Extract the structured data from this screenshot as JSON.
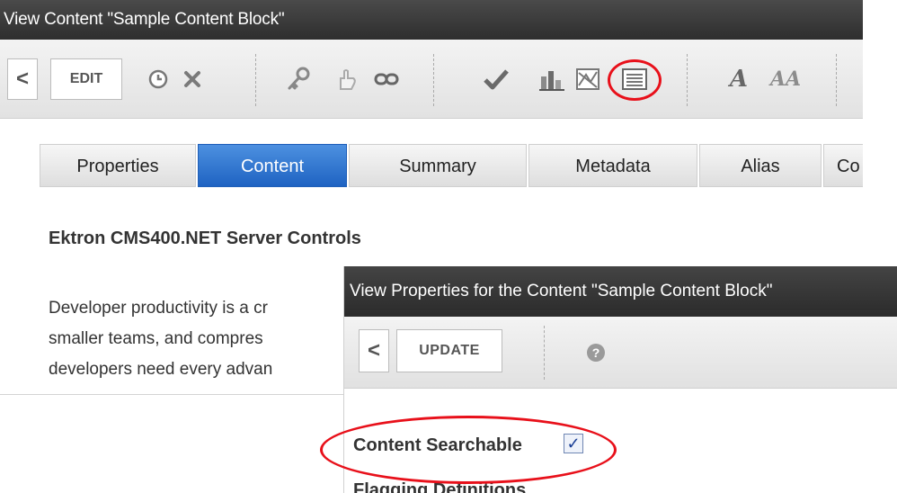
{
  "back_window": {
    "title": "View Content \"Sample Content Block\"",
    "toolbar": {
      "back_glyph": "<",
      "edit_label": "EDIT",
      "icons": [
        "clock-icon",
        "delete-icon",
        "permissions-icon",
        "workflow-icon",
        "link-icon",
        "approve-icon",
        "reports-icon",
        "chart-icon",
        "properties-icon",
        "spellcheck-icon",
        "translate-icon"
      ]
    },
    "tabs": [
      {
        "label": "Properties",
        "active": false
      },
      {
        "label": "Content",
        "active": true
      },
      {
        "label": "Summary",
        "active": false
      },
      {
        "label": "Metadata",
        "active": false
      },
      {
        "label": "Alias",
        "active": false
      },
      {
        "label": "Co",
        "active": false
      }
    ],
    "content_heading": "Ektron CMS400.NET Server Controls",
    "paragraph_lines": [
      "Developer productivity is a cr",
      "smaller teams, and compres",
      "developers need every advan"
    ]
  },
  "front_window": {
    "title": "View Properties for the Content \"Sample Content Block\"",
    "toolbar": {
      "back_glyph": "<",
      "update_label": "UPDATE",
      "help_glyph": "?"
    },
    "content_searchable_label": "Content Searchable",
    "content_searchable_checked": true,
    "checkmark": "✓",
    "next_section_label": "Flagging Definitions"
  },
  "colors": {
    "title_bar": "#2e2e2e",
    "active_tab": "#1f63c2",
    "highlight_ring": "#e8101a"
  }
}
